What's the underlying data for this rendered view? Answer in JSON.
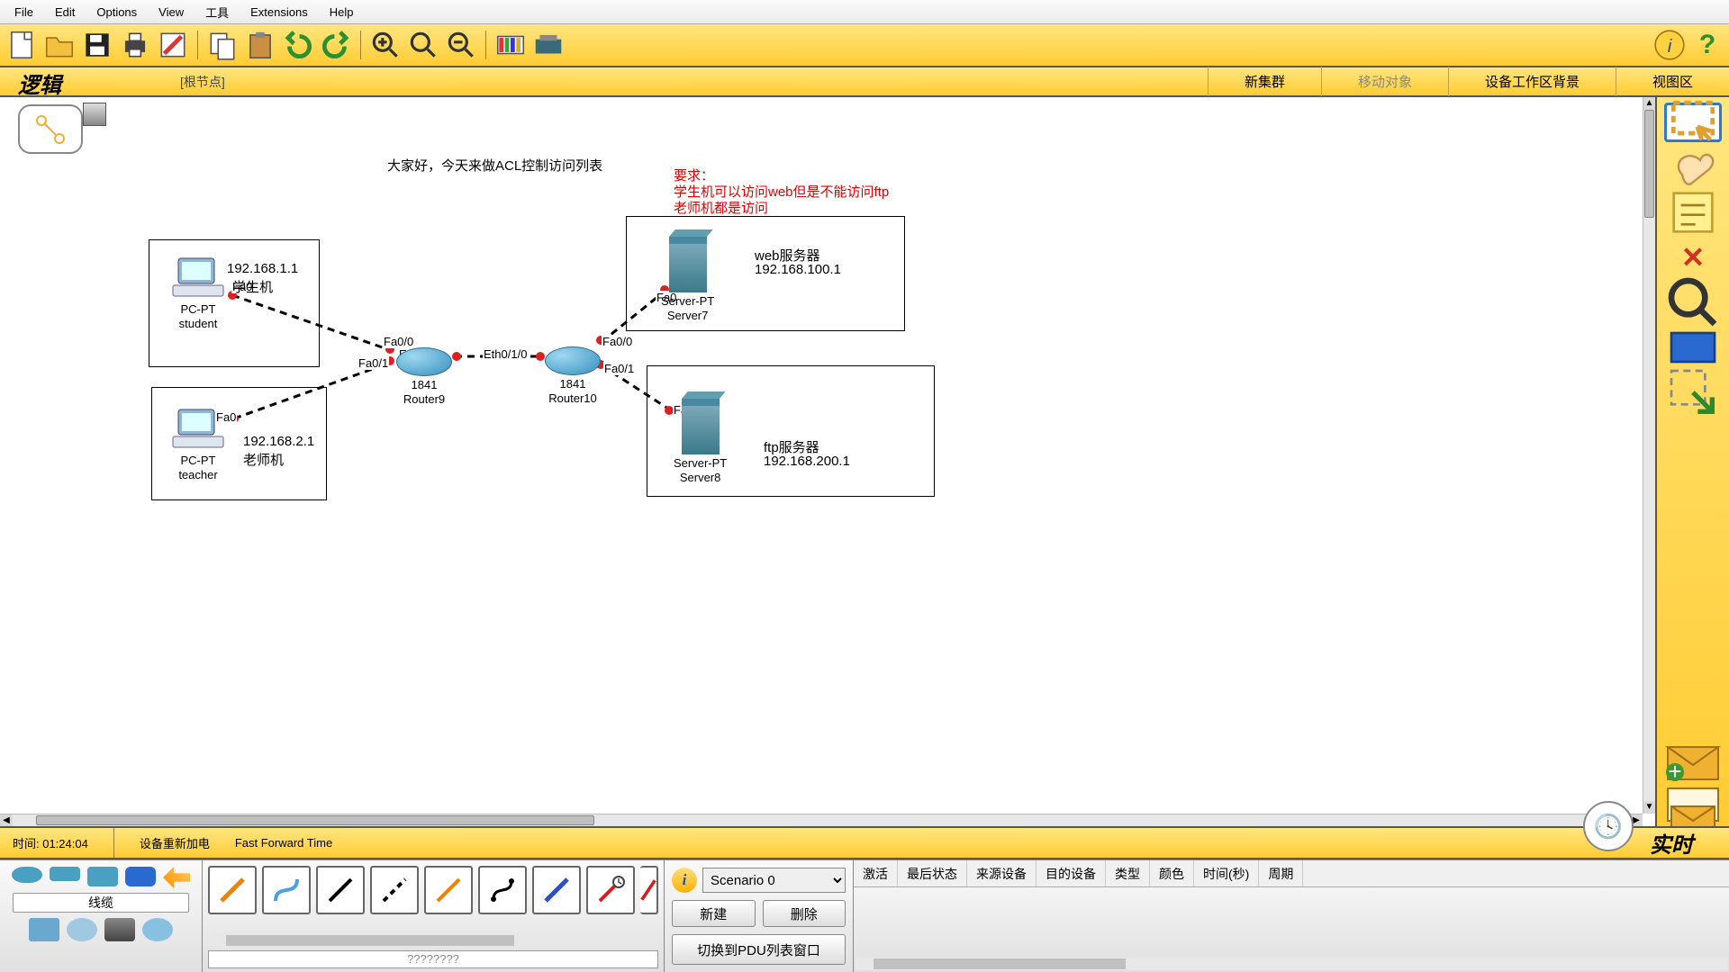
{
  "menu": {
    "file": "File",
    "edit": "Edit",
    "options": "Options",
    "view": "View",
    "tools": "工具",
    "extensions": "Extensions",
    "help": "Help"
  },
  "nav": {
    "logic": "逻辑",
    "root": "[根节点]",
    "newcluster": "新集群",
    "move": "移动对象",
    "bg": "设备工作区背景",
    "viewport": "视图区"
  },
  "canvas": {
    "title": "大家好，今天来做ACL控制访问列表",
    "req1": "要求：",
    "req2": "学生机可以访问web但是不能访问ftp",
    "req3": "老师机都是访问",
    "pc1": {
      "ip": "192.168.1.1",
      "role": "学生机",
      "type": "PC-PT",
      "name": "student"
    },
    "pc2": {
      "ip": "192.168.2.1",
      "role": "老师机",
      "type": "PC-PT",
      "name": "teacher"
    },
    "r1": {
      "model": "1841",
      "name": "Router9"
    },
    "r2": {
      "model": "1841",
      "name": "Router10"
    },
    "srv1": {
      "label": "web服务器",
      "ip": "192.168.100.1",
      "type": "Server-PT",
      "name": "Server7"
    },
    "srv2": {
      "label": "ftp服务器",
      "ip": "192.168.200.1",
      "type": "Server-PT",
      "name": "Server8"
    },
    "if": {
      "fa0": "Fa0",
      "fa00": "Fa0/0",
      "fa01": "Fa0/1",
      "eth010": "Eth0/1/0"
    }
  },
  "timebar": {
    "time": "时间: 01:24:04",
    "repower": "设备重新加电",
    "fft": "Fast Forward Time",
    "rt": "实时"
  },
  "palette": {
    "label": "线缆"
  },
  "cables": {
    "bottom": "????????"
  },
  "scenario": {
    "name": "Scenario 0",
    "new": "新建",
    "del": "删除",
    "toggle": "切换到PDU列表窗口"
  },
  "pdu": {
    "cols": [
      "激活",
      "最后状态",
      "来源设备",
      "目的设备",
      "类型",
      "颜色",
      "时间(秒)",
      "周期"
    ]
  }
}
